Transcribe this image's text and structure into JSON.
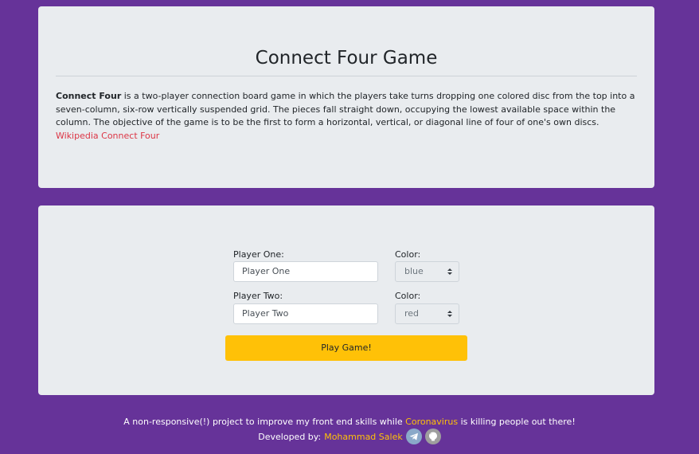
{
  "info": {
    "title": "Connect Four Game",
    "description_bold": "Connect Four",
    "description_rest": " is a two-player connection board game in which the players take turns dropping one colored disc from the top into a seven-column, six-row vertically suspended grid. The pieces fall straight down, occupying the lowest available space within the column. The objective of the game is to be the first to form a horizontal, vertical, or diagonal line of four of one's own discs.",
    "wiki_link": "Wikipedia Connect Four"
  },
  "form": {
    "player_one_label": "Player One:",
    "player_one_value": "Player One",
    "player_one_color_label": "Color:",
    "player_one_color": "blue",
    "player_two_label": "Player Two:",
    "player_two_value": "Player Two",
    "player_two_color_label": "Color:",
    "player_two_color": "red",
    "play_button": "Play Game!"
  },
  "footer": {
    "line1_before": "A non-responsive(!) project to improve my front end skills while ",
    "line1_link": "Coronavirus",
    "line1_after": " is killing people out there!",
    "line2_prefix": "Developed by: ",
    "developer": "Mohammad Salek",
    "icons": [
      "telegram-icon",
      "github-icon"
    ]
  },
  "colors": {
    "background": "#663399",
    "panel": "#e9ecef",
    "accent": "#ffc107",
    "link": "#dc3545"
  }
}
